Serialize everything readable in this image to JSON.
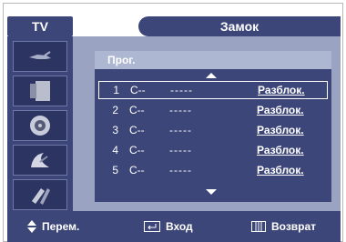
{
  "header": {
    "tab_label": "TV",
    "title": "Замок"
  },
  "sidebar": {
    "items": [
      {
        "icon": "antenna-icon"
      },
      {
        "icon": "tv-picture-icon"
      },
      {
        "icon": "speaker-sound-icon"
      },
      {
        "icon": "satellite-dish-icon"
      },
      {
        "icon": "setup-tools-icon"
      }
    ]
  },
  "panel": {
    "header_label": "Прог.",
    "rows": [
      {
        "num": "1",
        "ch": "C--",
        "name": "-----",
        "status": "Разблок.",
        "selected": true
      },
      {
        "num": "2",
        "ch": "C--",
        "name": "-----",
        "status": "Разблок.",
        "selected": false
      },
      {
        "num": "3",
        "ch": "C--",
        "name": "-----",
        "status": "Разблок.",
        "selected": false
      },
      {
        "num": "4",
        "ch": "C--",
        "name": "-----",
        "status": "Разблок.",
        "selected": false
      },
      {
        "num": "5",
        "ch": "C--",
        "name": "-----",
        "status": "Разблок.",
        "selected": false
      }
    ]
  },
  "bottom_bar": {
    "move_label": "Перем.",
    "enter_label": "Вход",
    "return_label": "Возврат"
  },
  "colors": {
    "menu_dark": "#3d4678",
    "menu_light": "#9aa3c2",
    "header_light": "#aeb7d2",
    "text": "#ffffff"
  }
}
